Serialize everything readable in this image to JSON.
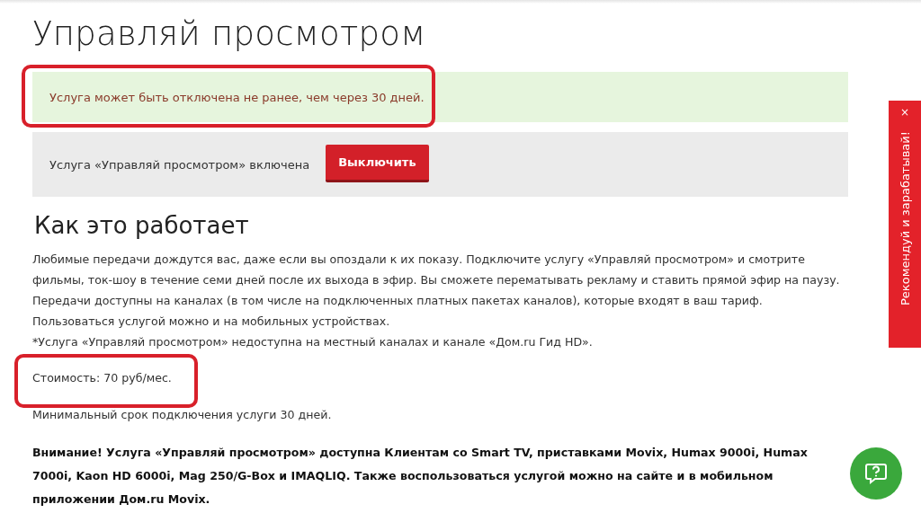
{
  "title": "Управляй просмотром",
  "notice": {
    "text": "Услуга может быть отключена не ранее, чем через 30 дней.",
    "highlighted": true
  },
  "service": {
    "status": "Услуга «Управляй просмотром» включена",
    "button": "Выключить"
  },
  "section_title": "Как это работает",
  "description": "Любимые передачи дождутся вас, даже если вы опоздали к их показу. Подключите услугу «Управляй просмотром» и смотрите фильмы, ток-шоу в течение семи дней после их выхода в эфир. Вы сможете перематывать рекламу и ставить прямой эфир на паузу. Передачи доступны на каналах (в том числе на подключенных платных пакетах каналов), которые входят в ваш тариф. Пользоваться услугой можно и на мобильных устройствах.",
  "footnote": "*Услуга «Управляй просмотром» недоступна на местный каналах и канале «Дом.ru Гид HD».",
  "price": {
    "text": "Стоимость: 70 руб/мес.",
    "highlighted": true
  },
  "minimum_term": "Минимальный срок подключения услуги 30 дней.",
  "warning": "Внимание! Услуга «Управляй просмотром» доступна Клиентам со Smart TV, приставками Movix, Humax 9000i, Humax 7000i, Kaon HD 6000i, Mag 250/G-Box и IMAQLIQ. Также воспользоваться услугой можно на сайте и в мобильном приложении Дом.ru Movix.",
  "side_tab": {
    "label": "Рекомендуй и зарабатывай!",
    "close": "×"
  }
}
